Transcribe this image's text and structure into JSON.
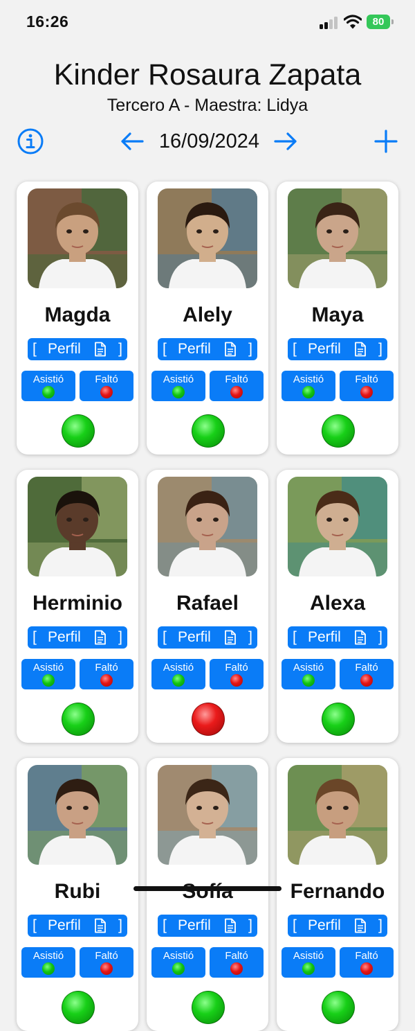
{
  "status_bar": {
    "time": "16:26",
    "battery": "80"
  },
  "header": {
    "title": "Kinder Rosaura Zapata",
    "subtitle": "Tercero A - Maestra: Lidya"
  },
  "nav": {
    "date": "16/09/2024"
  },
  "card_labels": {
    "perfil": "Perfil",
    "bracket_open": "[",
    "bracket_close": "]",
    "asistio": "Asistió",
    "falto": "Faltó"
  },
  "students": [
    {
      "name": "Magda",
      "status": "present",
      "status_color": "#12c412"
    },
    {
      "name": "Alely",
      "status": "present",
      "status_color": "#12c412"
    },
    {
      "name": "Maya",
      "status": "present",
      "status_color": "#12c412"
    },
    {
      "name": "Herminio",
      "status": "present",
      "status_color": "#12c412"
    },
    {
      "name": "Rafael",
      "status": "absent",
      "status_color": "#e41414"
    },
    {
      "name": "Alexa",
      "status": "present",
      "status_color": "#12c412"
    },
    {
      "name": "Rubi",
      "status": "present",
      "status_color": "#12c412"
    },
    {
      "name": "Sofía",
      "status": "present",
      "status_color": "#12c412"
    },
    {
      "name": "Fernando",
      "status": "present",
      "status_color": "#12c412"
    }
  ],
  "colors": {
    "accent": "#0a7cf7",
    "present": "#12c412",
    "absent": "#e41414",
    "background": "#f2f2f2"
  },
  "icons": {
    "info": "info-circle-icon",
    "prev": "arrow-left-icon",
    "next": "arrow-right-icon",
    "add": "plus-icon",
    "doc": "document-icon"
  }
}
